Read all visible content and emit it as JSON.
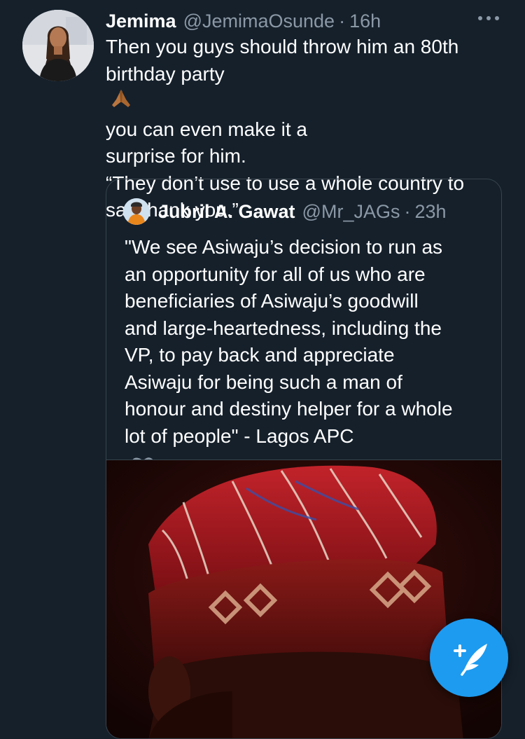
{
  "tweet": {
    "author_name": "Jemima",
    "author_handle": "@JemimaOsunde",
    "separator": "·",
    "time": "16h",
    "lines": [
      "Then you guys should throw him an 80th",
      "birthday party",
      "you can even make it a",
      "surprise for him.",
      "“They don’t use to use a whole country to",
      "say thank you.”"
    ],
    "emoji": "folded-hands-icon"
  },
  "quoted": {
    "author_name": "Jubril A. Gawat",
    "author_handle": "@Mr_JAGs",
    "separator": "·",
    "time": "23h",
    "lines": [
      "\"We see Asiwaju’s decision to run as",
      "an opportunity for all of us who are",
      "beneficiaries of Asiwaju’s goodwill",
      "and large-heartedness, including the",
      "VP, to pay back and appreciate",
      "Asiwaju for being such a man of",
      "honour and destiny helper for a whole",
      "lot of people\" - Lagos APC"
    ],
    "trailing_icon": "infinity-icon",
    "media": "red-cap-photo"
  },
  "icons": {
    "more": "more-options-icon",
    "compose": "compose-tweet-icon"
  },
  "colors": {
    "background": "#15202b",
    "secondary_text": "#8b98a5",
    "border": "#38444d",
    "accent": "#1d9bf0"
  }
}
